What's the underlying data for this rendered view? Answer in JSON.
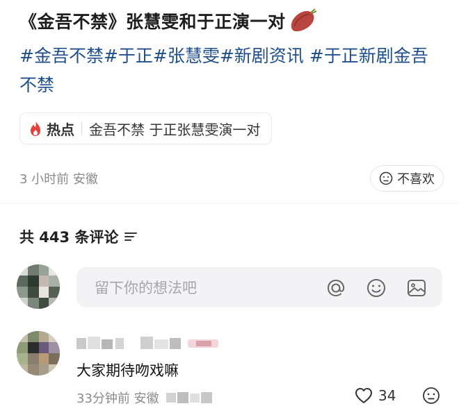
{
  "post": {
    "title": "《金吾不禁》张慧雯和于正演一对",
    "title_emoji": "sweet-potato-icon",
    "tags": [
      "#金吾不禁",
      "#于正",
      "#张慧雯",
      "#新剧资讯",
      " #于正新剧金吾不禁"
    ],
    "hot": {
      "label": "热点",
      "text": "金吾不禁 于正张慧雯演一对"
    },
    "time": "3 小时前",
    "location": "安徽",
    "dislike_label": "不喜欢"
  },
  "comments": {
    "count_label": "共 443 条评论",
    "input_placeholder": "留下你的想法吧",
    "items": [
      {
        "text": "大家期待吻戏嘛",
        "time": "33分钟前",
        "location": "安徽",
        "likes": "34"
      }
    ]
  },
  "colors": {
    "tag": "#1f4e8c",
    "hot_fire": "#e8413c",
    "muted": "#8a8a8a",
    "input_bg": "#f3f3f5"
  }
}
